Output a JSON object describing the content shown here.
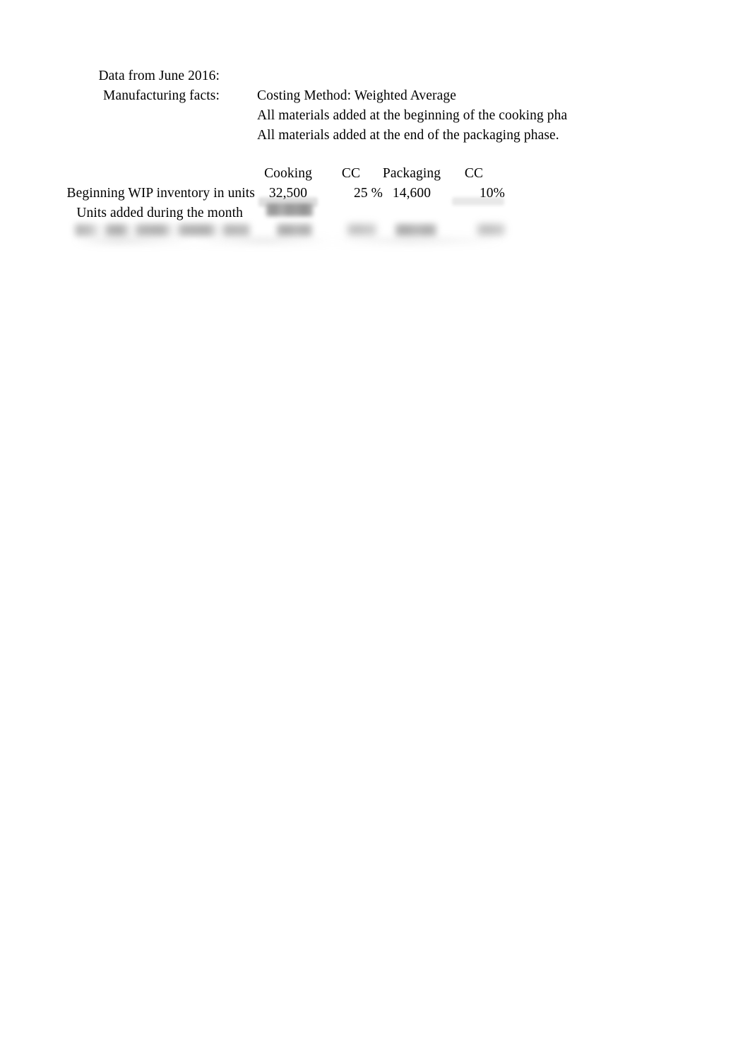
{
  "document": {
    "title": "Data from June 2016:",
    "facts_label": "Manufacturing facts:",
    "facts": [
      "Costing Method: Weighted Average",
      "All materials added at the beginning of the cooking pha",
      "All materials added at the end of the packaging phase."
    ]
  },
  "table": {
    "headers": {
      "row_label": "",
      "cooking": "Cooking",
      "cooking_cc": "CC",
      "packaging": "Packaging",
      "packaging_cc": "CC"
    },
    "rows": [
      {
        "label": "Beginning WIP inventory in units",
        "cooking": "32,500",
        "cooking_cc": "25 %",
        "packaging": "14,600",
        "packaging_cc": "10%",
        "legibility": "sharp"
      },
      {
        "label": "Units added during the month",
        "cooking": "",
        "cooking_cc": "",
        "packaging": "",
        "packaging_cc": "",
        "legibility": "label-sharp-values-blurred"
      },
      {
        "label": "",
        "cooking": "",
        "cooking_cc": "",
        "packaging": "",
        "packaging_cc": "",
        "legibility": "blurred"
      }
    ]
  }
}
